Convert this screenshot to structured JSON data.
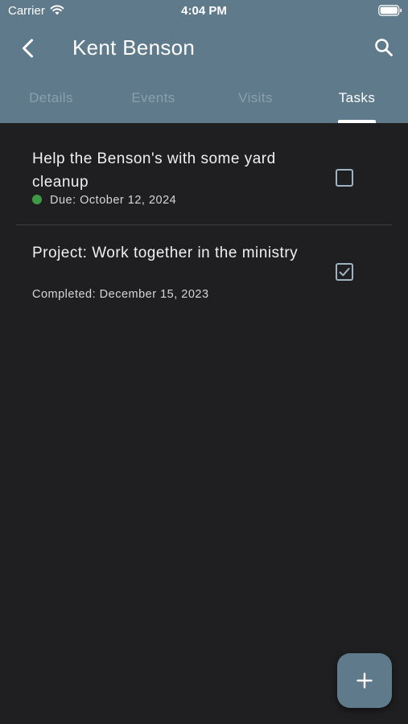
{
  "status_bar": {
    "carrier": "Carrier",
    "time": "4:04 PM"
  },
  "header": {
    "title": "Kent Benson"
  },
  "tabs": [
    {
      "label": "Details",
      "active": false
    },
    {
      "label": "Events",
      "active": false
    },
    {
      "label": "Visits",
      "active": false
    },
    {
      "label": "Tasks",
      "active": true
    }
  ],
  "tasks": [
    {
      "title": "Help the Benson's with some yard cleanup",
      "meta": "Due: October 12, 2024",
      "completed": false,
      "status_color": "#3f9a48"
    },
    {
      "title": "Project: Work together in the ministry",
      "meta": "Completed: December 15, 2023",
      "completed": true
    }
  ],
  "colors": {
    "accent": "#5f7a8a",
    "background": "#1f1f21"
  },
  "fab": {
    "icon": "plus-icon"
  }
}
